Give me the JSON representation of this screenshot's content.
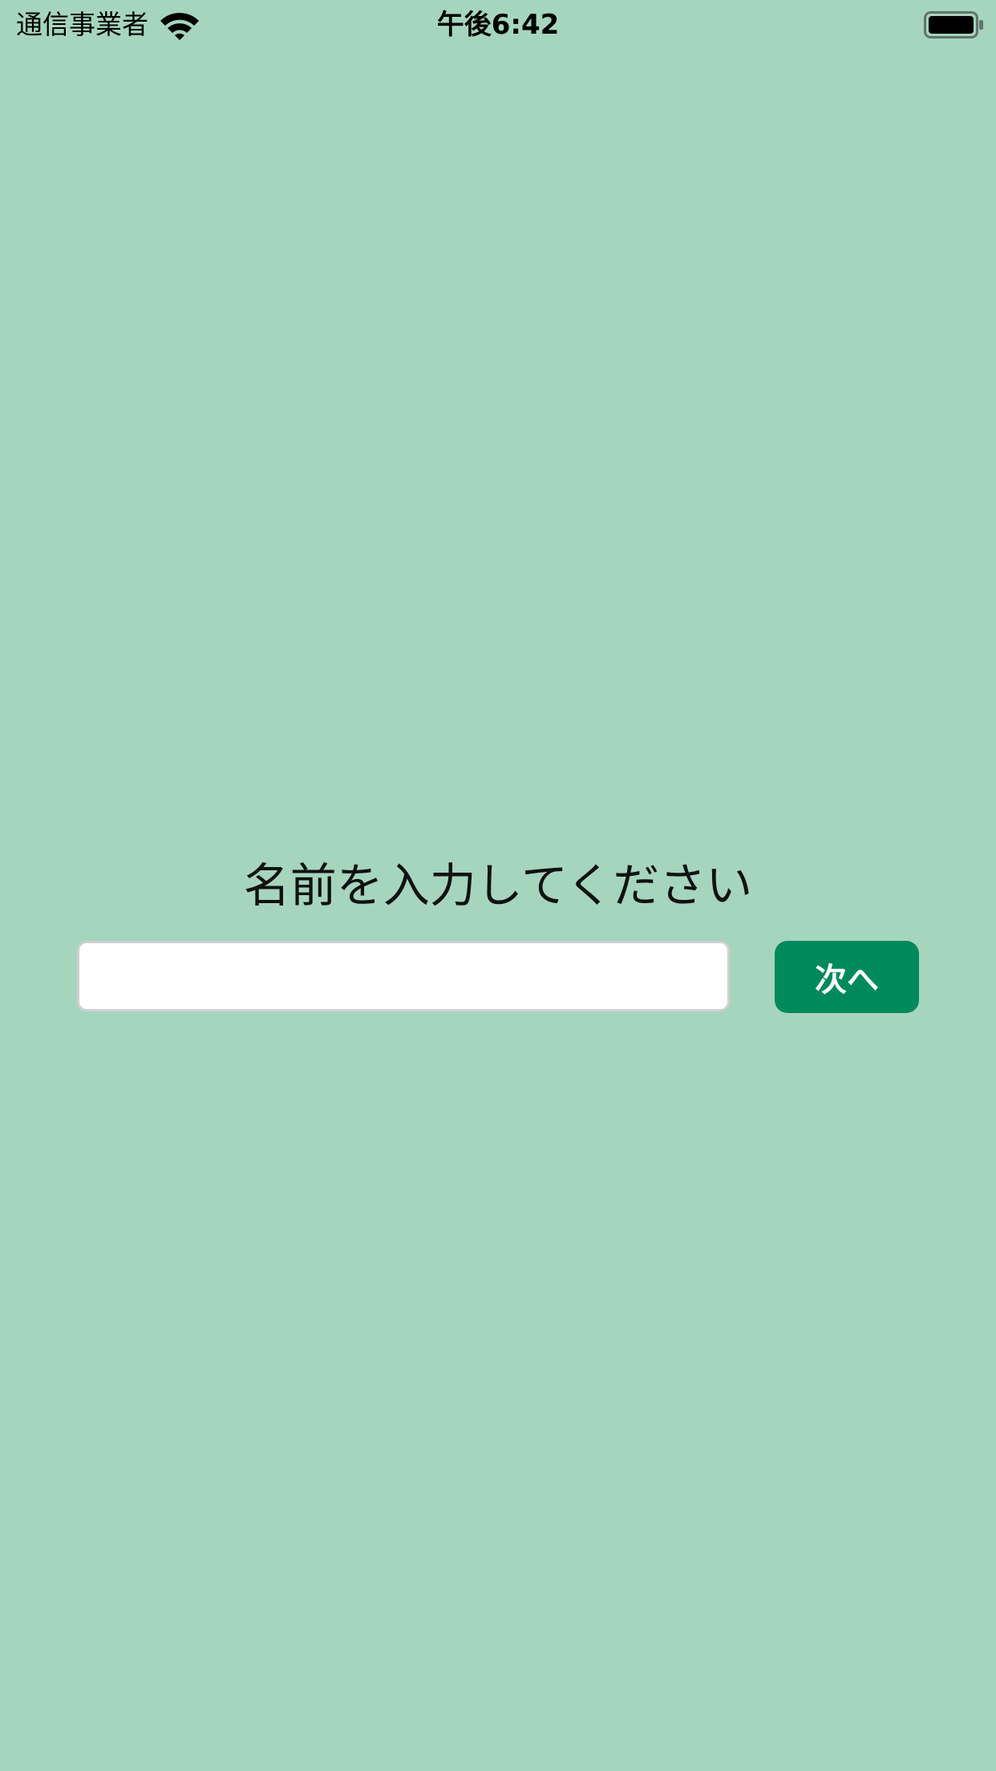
{
  "status_bar": {
    "carrier": "通信事業者",
    "time": "午後6:42",
    "wifi_icon": "wifi-icon",
    "battery_icon": "battery-full-icon",
    "battery_level": 1.0
  },
  "form": {
    "prompt": "名前を入力してください",
    "name_value": "",
    "name_placeholder": "",
    "next_label": "次へ"
  },
  "colors": {
    "background": "#a6d5bd",
    "accent": "#008a5c",
    "input_background": "#ffffff"
  }
}
